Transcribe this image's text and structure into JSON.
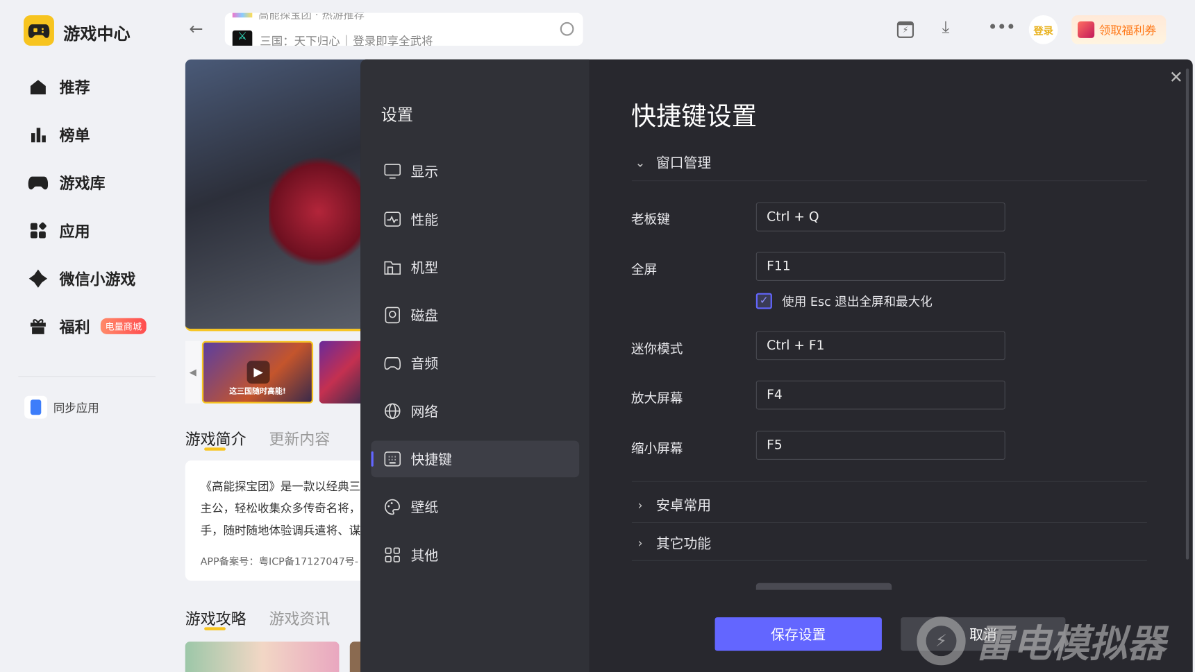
{
  "app": {
    "title": "游戏中心",
    "logo": "gamepad-logo"
  },
  "sidebar": {
    "items": [
      {
        "label": "推荐",
        "icon": "home-icon"
      },
      {
        "label": "榜单",
        "icon": "chart-icon"
      },
      {
        "label": "游戏库",
        "icon": "gamepad-icon"
      },
      {
        "label": "应用",
        "icon": "apps-icon"
      },
      {
        "label": "微信小游戏",
        "icon": "wechat-game-icon"
      },
      {
        "label": "福利",
        "icon": "gift-icon",
        "badge": "电量商城"
      }
    ],
    "sync": "同步应用"
  },
  "search": {
    "prev": "高能探宝团 · 热游推荐",
    "game": "三国：天下归心",
    "hint": "登录即享全武将"
  },
  "header": {
    "login": "登录",
    "coupon": "领取福利券"
  },
  "content": {
    "tabs1": [
      "游戏简介",
      "更新内容"
    ],
    "desc": [
      "《高能探宝团》是一款以经典三",
      "主公，轻松收集众多传奇名将，",
      "手，随时随地体验调兵遣将、谋"
    ],
    "icp": "APP备案号：粤ICP备17127047号-",
    "tabs2": [
      "游戏攻略",
      "游戏资讯"
    ],
    "thumb_caption": "这三国随时高能!"
  },
  "settings": {
    "title": "设置",
    "nav": [
      {
        "label": "显示",
        "icon": "monitor-icon"
      },
      {
        "label": "性能",
        "icon": "performance-icon"
      },
      {
        "label": "机型",
        "icon": "device-icon"
      },
      {
        "label": "磁盘",
        "icon": "disk-icon"
      },
      {
        "label": "音频",
        "icon": "audio-icon"
      },
      {
        "label": "网络",
        "icon": "globe-icon"
      },
      {
        "label": "快捷键",
        "icon": "keyboard-icon",
        "active": true
      },
      {
        "label": "壁纸",
        "icon": "palette-icon"
      },
      {
        "label": "其他",
        "icon": "grid-icon"
      }
    ],
    "heading": "快捷键设置",
    "sections": {
      "window": "窗口管理",
      "android": "安卓常用",
      "other": "其它功能"
    },
    "rows": [
      {
        "label": "老板键",
        "value": "Ctrl + Q"
      },
      {
        "label": "全屏",
        "value": "F11"
      },
      {
        "label": "迷你模式",
        "value": "Ctrl + F1"
      },
      {
        "label": "放大屏幕",
        "value": "F4"
      },
      {
        "label": "缩小屏幕",
        "value": "F5"
      }
    ],
    "esc_checkbox": {
      "label": "使用 Esc 退出全屏和最大化",
      "checked": true
    },
    "save": "保存设置",
    "cancel": "取消"
  },
  "watermark": "雷电模拟器",
  "colors": {
    "accent": "#6366ff",
    "brand": "#f7c41f"
  }
}
